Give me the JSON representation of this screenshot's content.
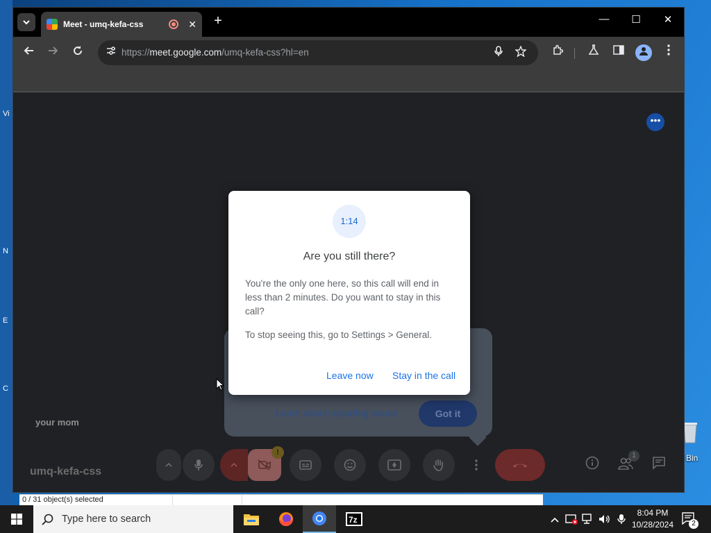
{
  "browser": {
    "tab_title": "Meet - umq-kefa-css",
    "url_scheme": "https://",
    "url_host": "meet.google.com",
    "url_path": "/umq-kefa-css?hl=en",
    "tab_close_glyph": "✕",
    "new_tab_glyph": "+",
    "minimize_glyph": "—",
    "maximize_glyph": "☐",
    "close_glyph": "✕"
  },
  "meet": {
    "more_glyph": "•••",
    "participant_name": "your mom",
    "meeting_code": "umq-kefa-css",
    "people_count": "1",
    "warning_glyph": "!",
    "report_bubble": {
      "link": "Learn about reporting abuse",
      "button": "Got it"
    }
  },
  "dialog": {
    "timer": "1:14",
    "title": "Are you still there?",
    "body": "You're the only one here, so this call will end in less than 2 minutes. Do you want to stay in this call?",
    "hint": "To stop seeing this, go to Settings > General.",
    "leave_button": "Leave now",
    "stay_button": "Stay in the call"
  },
  "desktop": {
    "explorer_status": "0 / 31 object(s) selected",
    "recycle_label": "Bin",
    "left_fragments": [
      "Vi",
      "N",
      "E",
      "C"
    ]
  },
  "taskbar": {
    "search_placeholder": "Type here to search",
    "time": "8:04 PM",
    "date": "10/28/2024",
    "notification_count": "2"
  },
  "icons": {
    "accent": "#1a73e8",
    "window_bg": "#202124",
    "end_call": "#6c2a2a"
  }
}
